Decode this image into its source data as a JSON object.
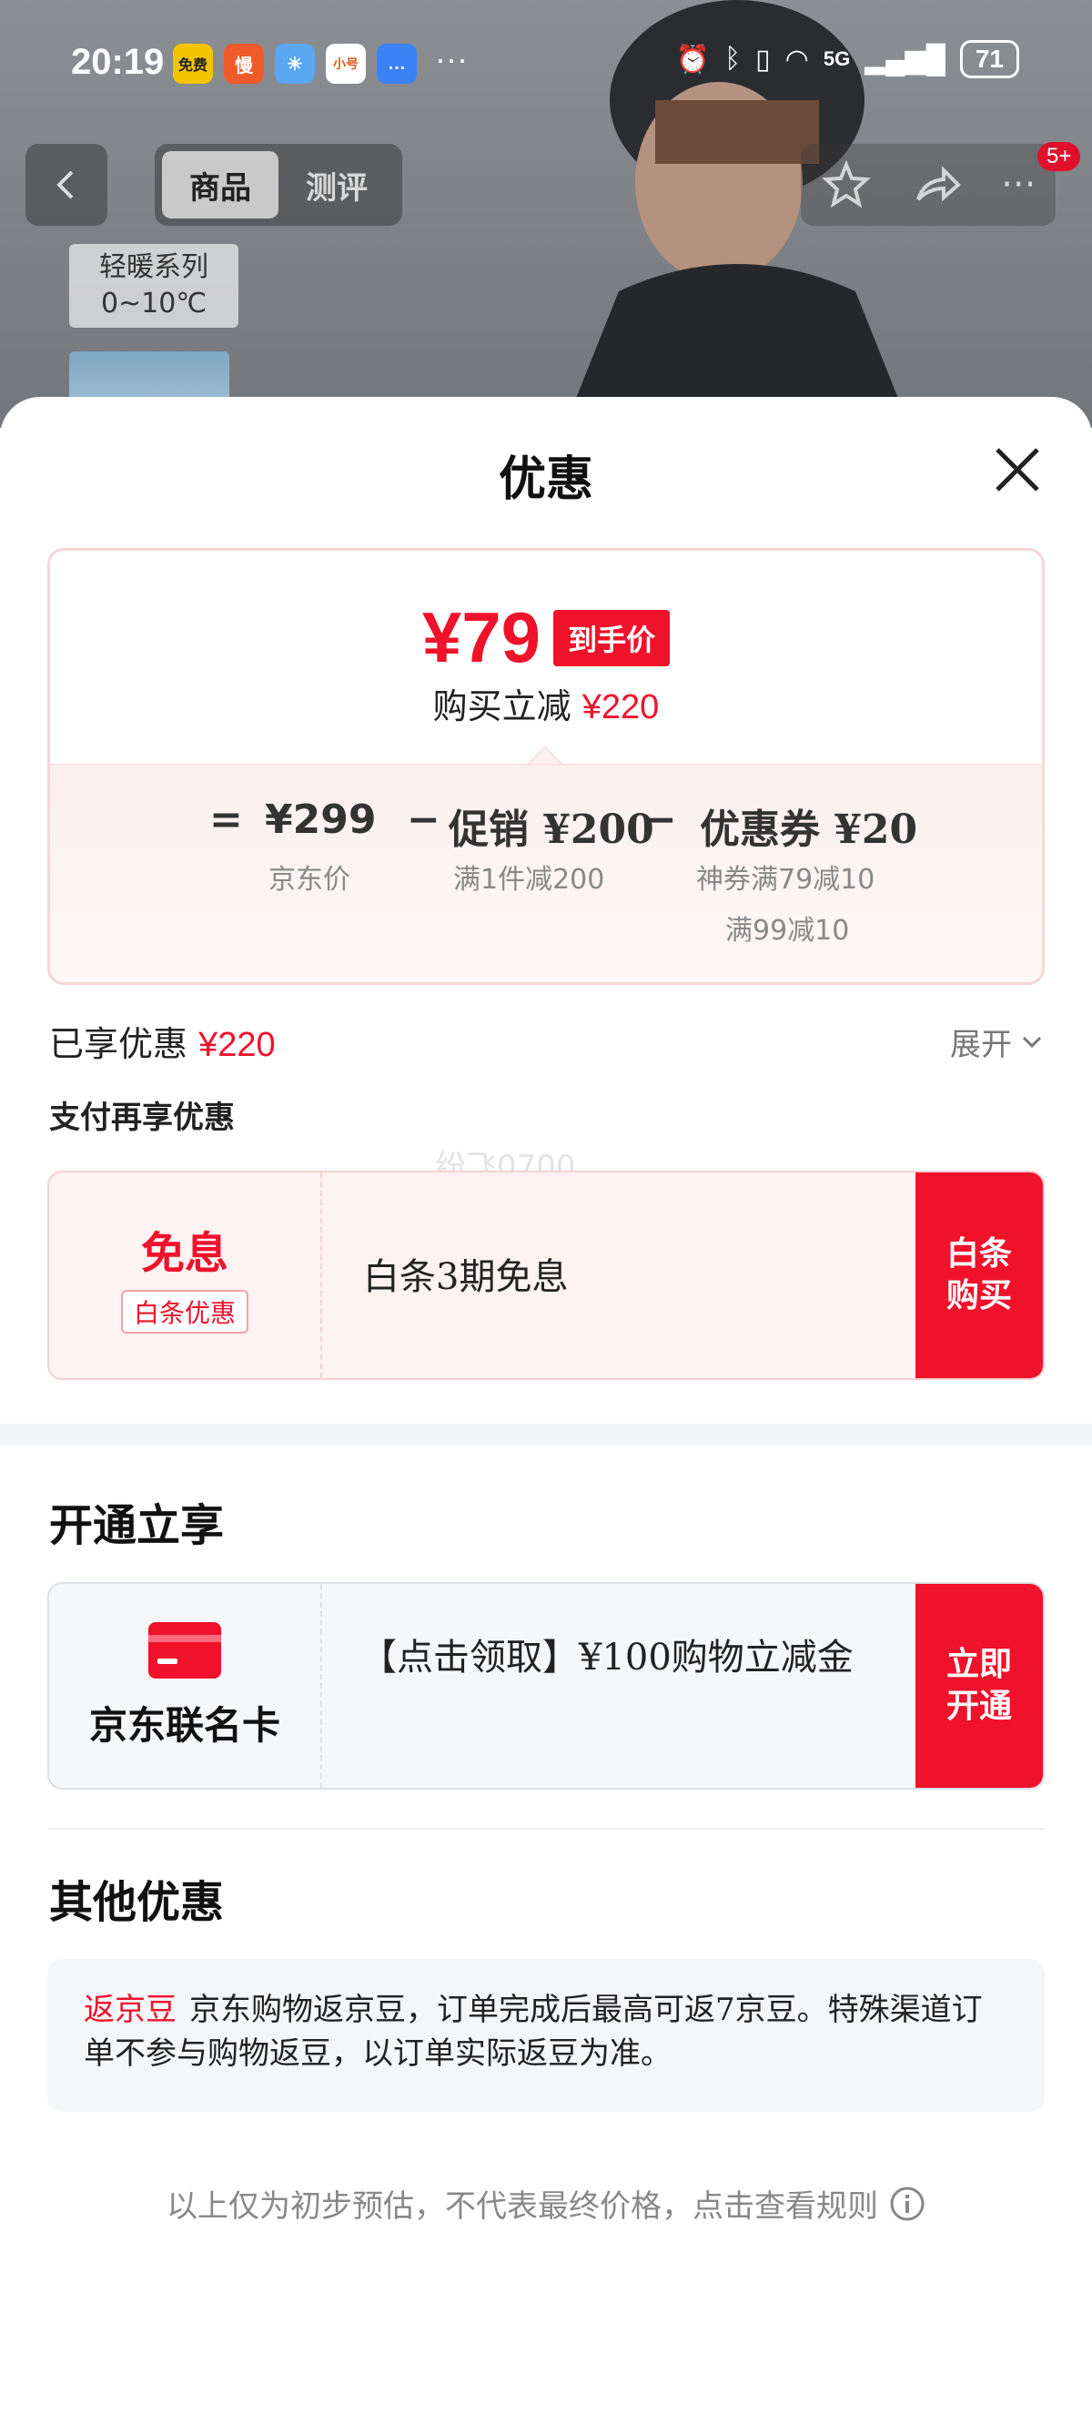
{
  "status_bar": {
    "time": "20:19",
    "apps": [
      "免费",
      "慢",
      "",
      "小号",
      ""
    ],
    "more": "···",
    "battery": "71",
    "network": "5G"
  },
  "background": {
    "tabs": [
      {
        "label": "商品",
        "active": true
      },
      {
        "label": "测评",
        "active": false
      }
    ],
    "badge": "5+",
    "series_line1": "轻暖系列",
    "series_line2": "0~10℃"
  },
  "sheet": {
    "title": "优惠",
    "price": {
      "main": "¥79",
      "tag": "到手价",
      "reduce_label": "购买立减",
      "reduce_amount": "¥220"
    },
    "formula": {
      "equals": "=",
      "minus": "−",
      "items": [
        {
          "value": "¥299",
          "sub": "京东价"
        },
        {
          "value": "促销 ¥200",
          "sub": "满1件减200"
        },
        {
          "value": "优惠券 ¥20",
          "sub": "神券满79减10",
          "sub2": "满99减10"
        }
      ]
    },
    "enjoyed_label": "已享优惠",
    "enjoyed_amount": "¥220",
    "expand_label": "展开",
    "pay_label": "支付再享优惠",
    "watermark": "纷飞0700",
    "baitiao": {
      "title": "免息",
      "sub": "白条优惠",
      "text": "白条3期免息",
      "button": "白条购买"
    },
    "open_title": "开通立享",
    "card": {
      "name": "京东联名卡",
      "text": "【点击领取】¥100购物立减金",
      "button": "立即开通"
    },
    "other_title": "其他优惠",
    "other": {
      "tag": "返京豆",
      "text": "京东购物返京豆，订单完成后最高可返7京豆。特殊渠道订单不参与购物返豆，以订单实际返豆为准。"
    },
    "footer": "以上仅为初步预估，不代表最终价格，点击查看规则"
  },
  "colors": {
    "accent": "#f0112b",
    "card_bg": "#fef2f2"
  }
}
